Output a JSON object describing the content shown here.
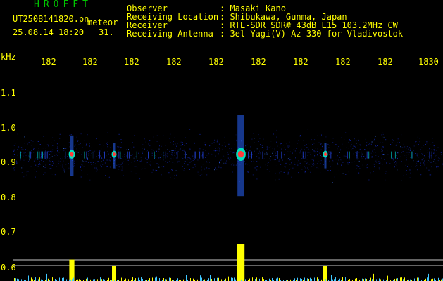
{
  "header": {
    "brand": "HROFFT",
    "filename": "UT2508141820.pn",
    "tag": "meteor",
    "datetime": "25.08.14 18:20",
    "count": "31.",
    "info_labels": [
      "Observer",
      "Receiving Location",
      "Receiver",
      "Receiving Antenna"
    ],
    "info_values": [
      ": Masaki Kano",
      ": Shibukawa, Gunma, Japan",
      ": RTL-SDR SDR# 43dB L15 103.2MHz CW",
      ": 3el Yagi(V) Az 330 for Vladivostok"
    ]
  },
  "axis": {
    "unit": "kHz",
    "x_ticks": [
      "182",
      "182",
      "182",
      "182",
      "182",
      "182",
      "182",
      "182",
      "182",
      "1830"
    ],
    "y_ticks": [
      "1.1",
      "1.0",
      "0.9",
      "0.8",
      "0.7",
      "0.6"
    ]
  },
  "colors": {
    "text": "#ffff00",
    "brand": "#00c800",
    "background": "#000000",
    "noise": "#1428b4",
    "strong": "#ff3c3c",
    "activity": "#ffff00",
    "baseline": "#40c8ff"
  },
  "chart_data": {
    "type": "heatmap",
    "xlabel": "",
    "ylabel": "kHz",
    "x_ticks": [
      "182",
      "182",
      "182",
      "182",
      "182",
      "182",
      "182",
      "182",
      "182",
      "1830"
    ],
    "y_ticks": [
      1.1,
      1.0,
      0.9,
      0.8,
      0.7,
      0.6
    ],
    "ylim": [
      0.58,
      1.14
    ],
    "echo_center_khz": 0.92,
    "events": [
      {
        "minute_index": 1,
        "intensity": "medium"
      },
      {
        "minute_index": 2,
        "intensity": "low"
      },
      {
        "minute_index": 5,
        "intensity": "high"
      },
      {
        "minute_index": 7,
        "intensity": "low"
      }
    ]
  }
}
